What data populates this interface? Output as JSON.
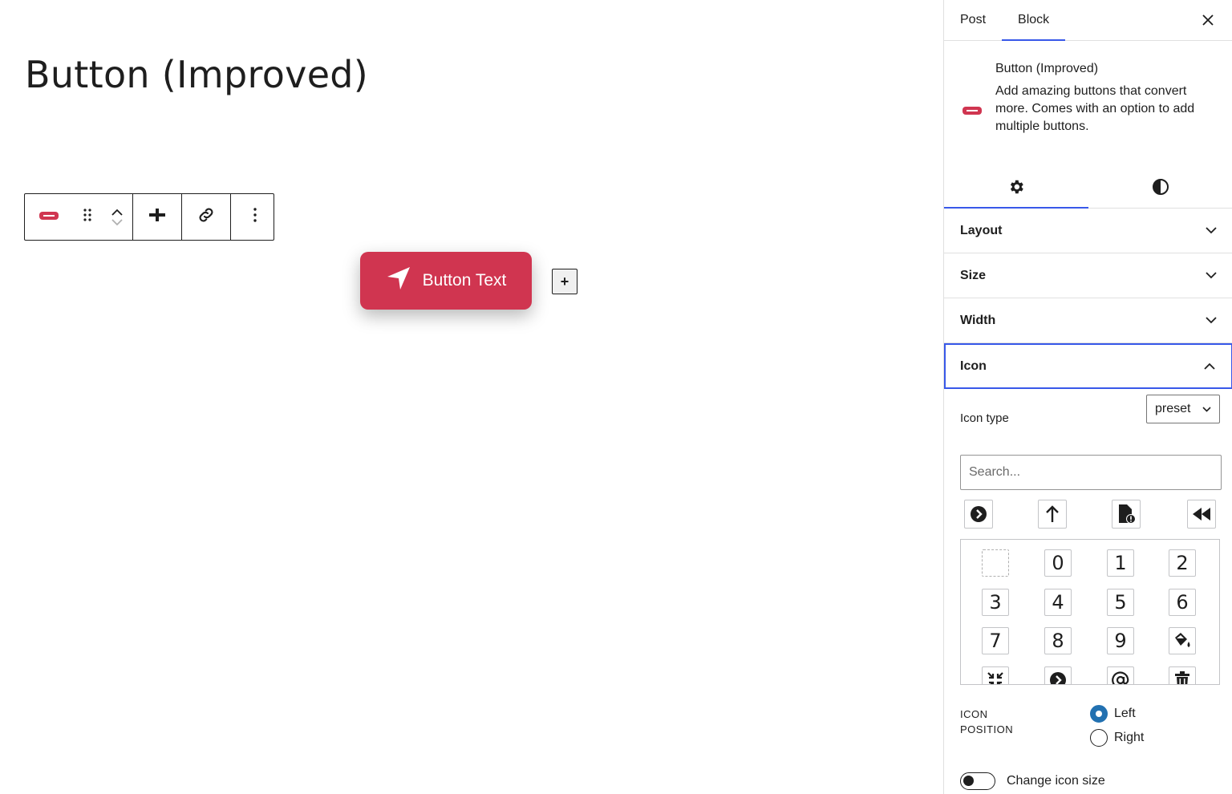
{
  "editor": {
    "title": "Button (Improved)",
    "button_text": "Button Text",
    "inline_add_symbol": "+",
    "toolbar": {
      "block_icon": "button-block-icon",
      "drag_icon": "drag-handle-icon",
      "move_up_icon": "chevron-up-icon",
      "move_down_icon": "chevron-down-icon",
      "add_icon": "add-button-icon",
      "link_icon": "link-icon",
      "more_icon": "more-vertical-icon"
    },
    "button_icon": "navigation-arrow-icon"
  },
  "sidebar": {
    "tabs": [
      {
        "label": "Post",
        "active": false
      },
      {
        "label": "Block",
        "active": true
      }
    ],
    "close_icon": "close-icon",
    "block_card": {
      "title": "Button (Improved)",
      "description": "Add amazing buttons that convert more. Comes with an option to add multiple buttons."
    },
    "inspector_tabs": [
      {
        "icon": "gear-icon",
        "active": true
      },
      {
        "icon": "contrast-icon",
        "active": false
      }
    ],
    "panels": [
      {
        "label": "Layout",
        "open": false
      },
      {
        "label": "Size",
        "open": false
      },
      {
        "label": "Width",
        "open": false
      },
      {
        "label": "Icon",
        "open": true
      }
    ],
    "icon_panel": {
      "icon_type_label": "Icon type",
      "icon_type_value": "preset",
      "search_placeholder": "Search...",
      "recent_icons": [
        "chevron-circle-right-icon",
        "arrow-up-icon",
        "file-alert-icon",
        "backward-icon"
      ],
      "grid": [
        {
          "kind": "empty",
          "glyph": ""
        },
        {
          "kind": "text",
          "glyph": "0"
        },
        {
          "kind": "text",
          "glyph": "1"
        },
        {
          "kind": "text",
          "glyph": "2"
        },
        {
          "kind": "text",
          "glyph": "3"
        },
        {
          "kind": "text",
          "glyph": "4"
        },
        {
          "kind": "text",
          "glyph": "5"
        },
        {
          "kind": "text",
          "glyph": "6"
        },
        {
          "kind": "text",
          "glyph": "7"
        },
        {
          "kind": "text",
          "glyph": "8"
        },
        {
          "kind": "text",
          "glyph": "9"
        },
        {
          "kind": "icon",
          "glyph": "paint-bucket-icon"
        },
        {
          "kind": "icon",
          "glyph": "compress-arrows-icon"
        },
        {
          "kind": "icon",
          "glyph": "chevron-circle-right-icon"
        },
        {
          "kind": "icon",
          "glyph": "at-sign-icon"
        },
        {
          "kind": "icon",
          "glyph": "trash-icon"
        }
      ],
      "position_label_line1": "ICON",
      "position_label_line2": "POSITION",
      "position_options": [
        {
          "label": "Left",
          "checked": true
        },
        {
          "label": "Right",
          "checked": false
        }
      ],
      "toggle_label": "Change icon size",
      "toggle_on": false
    }
  },
  "colors": {
    "accent": "#d03550",
    "tab_indicator": "#3858e9",
    "radio_checked": "#2271b1"
  }
}
